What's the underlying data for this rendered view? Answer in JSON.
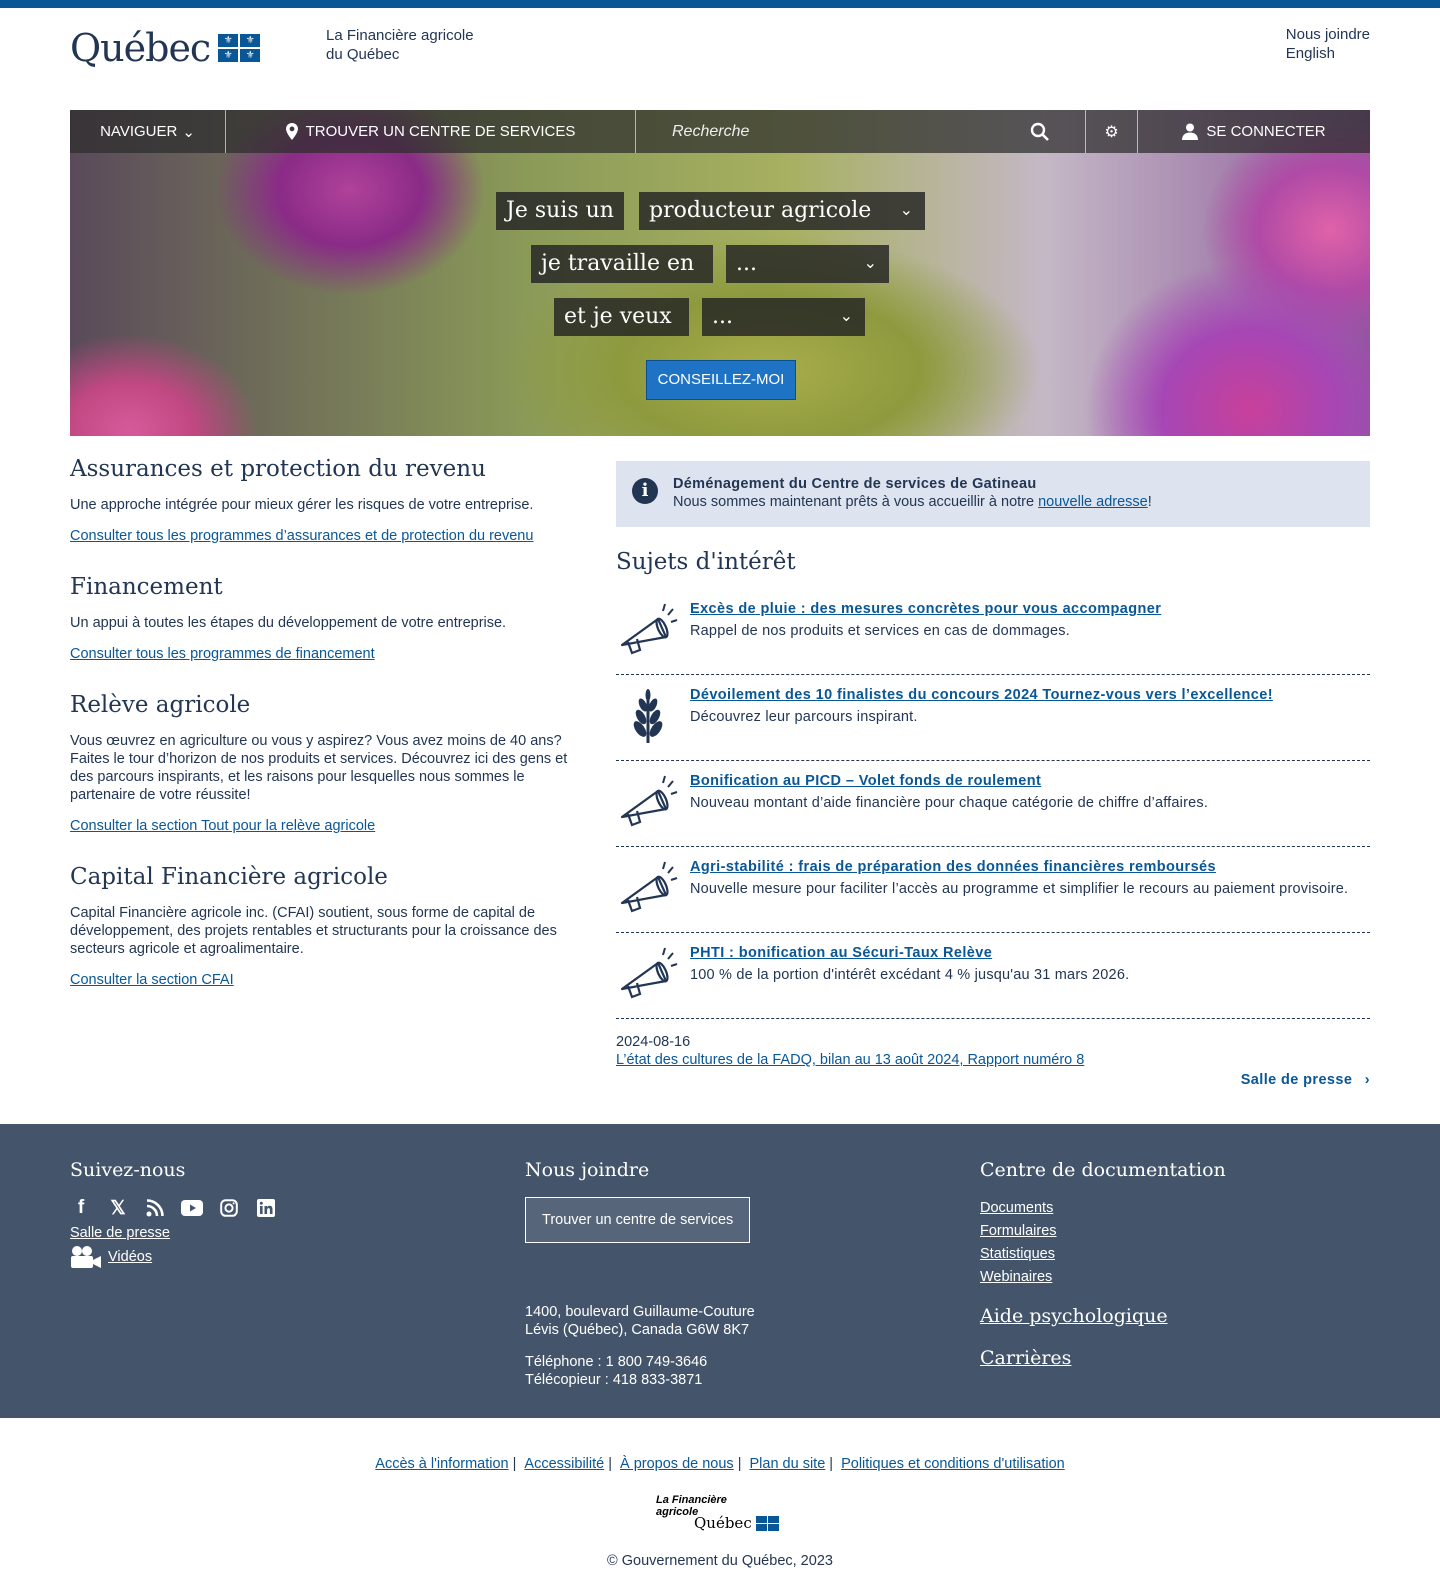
{
  "header": {
    "logo_word": "Québec",
    "org_line1": "La Financière agricole",
    "org_line2": "du Québec",
    "contact_link": "Nous joindre",
    "language_link": "English"
  },
  "nav": {
    "navigate": "NAVIGUER",
    "find_center": "TROUVER UN CENTRE DE SERVICES",
    "search_placeholder": "Recherche",
    "login": "SE CONNECTER"
  },
  "hero": {
    "phrase1": "Je suis un",
    "select1": "producteur agricole",
    "phrase2": "je travaille en",
    "select2": "...",
    "phrase3": "et je veux",
    "select3": "...",
    "cta": "CONSEILLEZ-MOI"
  },
  "sections": [
    {
      "title": "Assurances et protection du revenu",
      "text": "Une approche intégrée pour mieux gérer les risques de votre entreprise.",
      "link": "Consulter tous les programmes d’assurances et de protection du revenu"
    },
    {
      "title": "Financement",
      "text": "Un appui à toutes les étapes du développement de votre entreprise.",
      "link": "Consulter tous les programmes de financement"
    },
    {
      "title": "Relève agricole",
      "text": "Vous œuvrez en agriculture ou vous y aspirez? Vous avez moins de 40 ans? Faites le tour d’horizon de nos produits et services. Découvrez ici des gens et des parcours inspirants, et les raisons pour lesquelles nous sommes le partenaire de votre réussite!",
      "link": "Consulter la section Tout pour la relève agricole"
    },
    {
      "title": "Capital Financière agricole",
      "text": "Capital Financière agricole inc. (CFAI) soutient, sous forme de capital de développement, des projets rentables et structurants pour la croissance des secteurs agricole et agroalimentaire.",
      "link": "Consulter la section CFAI"
    }
  ],
  "alert": {
    "title": "Déménagement du Centre de services de Gatineau",
    "text_before": "Nous sommes maintenant prêts à vous accueillir à notre ",
    "link": "nouvelle adresse",
    "text_after": "!"
  },
  "topics": {
    "title": "Sujets d'intérêt",
    "items": [
      {
        "icon": "megaphone-icon",
        "link": "Excès de pluie : des mesures concrètes pour vous accompagner",
        "text": "Rappel de nos produits et services en cas de dommages."
      },
      {
        "icon": "wheat-icon",
        "link": "Dévoilement des 10 finalistes du concours 2024 Tournez-vous vers l’excellence!",
        "text": "Découvrez leur parcours inspirant."
      },
      {
        "icon": "megaphone-icon",
        "link": "Bonification au PICD – Volet fonds de roulement",
        "text": "Nouveau montant d’aide financière pour chaque catégorie de chiffre d’affaires."
      },
      {
        "icon": "megaphone-icon",
        "link": "Agri-stabilité : frais de préparation des données financières remboursés",
        "text": "Nouvelle mesure pour faciliter l’accès au programme et simplifier le recours au paiement provisoire."
      },
      {
        "icon": "megaphone-icon",
        "link": "PHTI : bonification au Sécuri-Taux Relève",
        "text": "100 % de la portion d'intérêt excédant 4 % jusqu'au 31 mars 2026."
      }
    ],
    "news_date": "2024-08-16",
    "news_link": "L’état des cultures de la FADQ, bilan au 13 août 2024, Rapport numéro 8",
    "press_link": "Salle de presse"
  },
  "footer": {
    "follow_title": "Suivez-nous",
    "press_link": "Salle de presse",
    "videos_link": "Vidéos",
    "contact_title": "Nous joindre",
    "find_button": "Trouver un centre de services",
    "address1": "1400, boulevard Guillaume-Couture",
    "address2": "Lévis (Québec), Canada G6W 8K7",
    "phone": "Téléphone : 1 800 749-3646",
    "fax": "Télécopieur : 418 833-3871",
    "docs_title": "Centre de documentation",
    "doc_links": [
      "Documents",
      "Formulaires",
      "Statistiques",
      "Webinaires"
    ],
    "psy_link": "Aide psychologique",
    "careers_link": "Carrières"
  },
  "bottom": {
    "links": [
      "Accès à l'information",
      "Accessibilité",
      "À propos de nous",
      "Plan du site",
      "Politiques et conditions d'utilisation"
    ],
    "logo_line1": "La Financière",
    "logo_line2": "agricole",
    "logo_word": "Québec",
    "copyright": "© Gouvernement du Québec, 2023"
  },
  "colors": {
    "primary": "#095797",
    "text": "#223654",
    "footer_bg": "#44556b",
    "alert_bg": "#dde4ef",
    "cta": "#1f73c4"
  }
}
